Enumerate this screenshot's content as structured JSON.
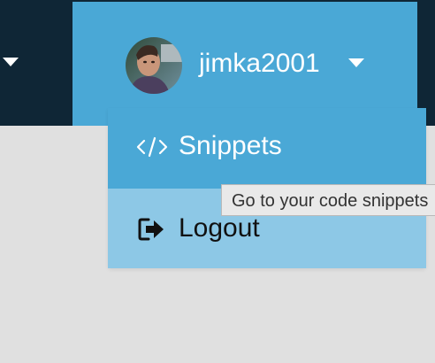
{
  "navbar": {
    "left_caret_icon": "caret-down-icon",
    "colors": {
      "background": "#0f2636",
      "active": "#4aa8d6"
    }
  },
  "user_menu": {
    "avatar_icon": "user-avatar",
    "username": "jimka2001",
    "caret_icon": "caret-down-icon"
  },
  "dropdown": {
    "items": [
      {
        "icon": "code-icon",
        "label": "Snippets"
      },
      {
        "icon": "sign-out-icon",
        "label": "Logout"
      }
    ],
    "colors": {
      "active": "#4aa8d6",
      "inactive": "#8dc8e6"
    }
  },
  "tooltip": {
    "text": "Go to your code snippets"
  }
}
